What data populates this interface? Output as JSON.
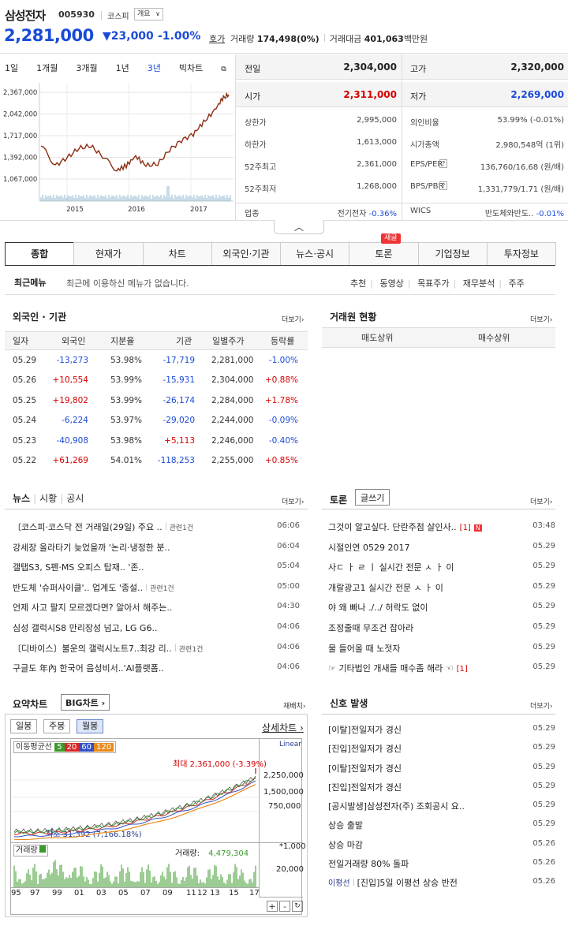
{
  "header": {
    "name": "삼성전자",
    "code": "005930",
    "market": "코스피",
    "overview_dd": "개요",
    "price": "2,281,000",
    "change": "▼23,000",
    "change_pct": "-1.00%",
    "hoga": "호가",
    "vol_label": "거래량",
    "vol": "174,498(0%)",
    "amt_label": "거래대금",
    "amt": "401,063",
    "amt_unit": "백만원"
  },
  "periods": [
    "1일",
    "1개월",
    "3개월",
    "1년",
    "3년",
    "빅차트"
  ],
  "mini_chart": {
    "y_ticks": [
      "2,367,000",
      "2,042,000",
      "1,717,000",
      "1,392,000",
      "1,067,000"
    ],
    "x_ticks": [
      "2015",
      "2016",
      "2017"
    ],
    "line_color": "#8b2e12"
  },
  "info": {
    "prev_label": "전일",
    "prev": "2,304,000",
    "high_label": "고가",
    "high": "2,320,000",
    "open_label": "시가",
    "open": "2,311,000",
    "low_label": "저가",
    "low": "2,269,000",
    "rows": [
      {
        "l": "상한가",
        "v": "2,995,000",
        "l2": "외인비율",
        "v2": "53.99% (-0.01%)"
      },
      {
        "l": "하한가",
        "v": "1,613,000",
        "l2": "시가총액",
        "v2": "2,980,548억 (1위)"
      },
      {
        "l": "52주최고",
        "v": "2,361,000",
        "l2": "EPS/PER",
        "v2": "136,760/16.68 (원/배)"
      },
      {
        "l": "52주최저",
        "v": "1,268,000",
        "l2": "BPS/PBR",
        "v2": "1,331,779/1.71 (원/배)"
      }
    ],
    "sector_label": "업종",
    "sector": "전기전자",
    "sector_chg": "-0.36%",
    "wics_label": "WICS",
    "wics": "반도체와반도..",
    "wics_chg": "-0.01%"
  },
  "tabs": [
    "종합",
    "현재가",
    "차트",
    "외국인·기관",
    "뉴스·공시",
    "토론",
    "기업정보",
    "투자정보"
  ],
  "new_badge": "새글",
  "recent": {
    "label": "최근메뉴",
    "text": "최근에 이용하신 메뉴가 없습니다.",
    "links": [
      "추천",
      "동영상",
      "목표주가",
      "재무분석",
      "주주"
    ]
  },
  "foreign": {
    "title": "외국인 · 기관",
    "more": "더보기",
    "headers": [
      "일자",
      "외국인",
      "지분율",
      "기관",
      "일별주가",
      "등락률"
    ],
    "rows": [
      [
        "05.29",
        "-13,273",
        "53.98%",
        "-17,719",
        "2,281,000",
        "-1.00%"
      ],
      [
        "05.26",
        "+10,554",
        "53.99%",
        "-15,931",
        "2,304,000",
        "+0.88%"
      ],
      [
        "05.25",
        "+19,802",
        "53.99%",
        "-26,174",
        "2,284,000",
        "+1.78%"
      ],
      [
        "05.24",
        "-6,224",
        "53.97%",
        "-29,020",
        "2,244,000",
        "-0.09%"
      ],
      [
        "05.23",
        "-40,908",
        "53.98%",
        "+5,113",
        "2,246,000",
        "-0.40%"
      ],
      [
        "05.22",
        "+61,269",
        "54.01%",
        "-118,253",
        "2,255,000",
        "+0.85%"
      ]
    ]
  },
  "broker": {
    "title": "거래원 현황",
    "more": "더보기",
    "sell": "매도상위",
    "buy": "매수상위"
  },
  "news": {
    "tabs": [
      "뉴스",
      "시황",
      "공시"
    ],
    "more": "더보기",
    "items": [
      {
        "t": "〔코스피·코스닥 전 거래일(29일) 주요 ..",
        "rel": "관련1건",
        "d": "06:06"
      },
      {
        "t": "강세장 올라타기 늦었을까 '논리·냉정한 분..",
        "rel": "",
        "d": "06:04"
      },
      {
        "t": "갤탭S3, S펜·MS 오피스 탑재.. '존..",
        "rel": "",
        "d": "05:04"
      },
      {
        "t": "반도체 '슈퍼사이클'.. 업계도 '종설..",
        "rel": "관련1건",
        "d": "05:00"
      },
      {
        "t": "언제 사고 팔지 모르겠다면? 알아서 해주는..",
        "rel": "",
        "d": "04:30"
      },
      {
        "t": "심성 갤럭시S8 만리장성 넘고, LG G6..",
        "rel": "",
        "d": "04:06"
      },
      {
        "t": "〔디바이스〕불운의 갤럭시노트7..최강 리..",
        "rel": "관련1건",
        "d": "04:06"
      },
      {
        "t": "구글도 年內 한국어 음성비서..'AI플랫폼..",
        "rel": "",
        "d": "04:06"
      }
    ]
  },
  "forum": {
    "title": "토론",
    "write": "글쓰기",
    "more": "더보기",
    "items": [
      {
        "t": "그것이 알고싶다. 단란주점 살인사..",
        "c": "[1]",
        "n": "N",
        "d": "03:48"
      },
      {
        "t": "시절인연 0529 2017",
        "c": "",
        "n": "",
        "d": "05.29"
      },
      {
        "t": "사ㄷ ㅏ ㄹ ㅣ 실시간 전문 ㅅ ㅏ 이",
        "c": "",
        "n": "",
        "d": "05.29"
      },
      {
        "t": "개랄광고1 실시간 전문 ㅅ ㅏ 이",
        "c": "",
        "n": "",
        "d": "05.29"
      },
      {
        "t": "야 왜 빠나 ./../ 허락도 없이",
        "c": "",
        "n": "",
        "d": "05.29"
      },
      {
        "t": "조정줄때 무조건 잡아라",
        "c": "",
        "n": "",
        "d": "05.29"
      },
      {
        "t": "물 들어올 때 노젓자",
        "c": "",
        "n": "",
        "d": "05.29"
      },
      {
        "t": "☞ 기타법인 개새들 매수좀 해라 ☜",
        "c": "[1]",
        "n": "",
        "d": "05.29"
      }
    ]
  },
  "summary_chart": {
    "title": "요약차트",
    "big": "BIG차트",
    "refresh": "재배치",
    "btns": [
      "일봉",
      "주봉",
      "월봉"
    ],
    "detail": "상세차트",
    "ma_label": "이동평균선",
    "ma": [
      "5",
      "20",
      "60",
      "120"
    ],
    "scale": "Linear",
    "max_label": "최대",
    "max_val": "2,361,000 (-3.39%)",
    "min_label": "최소",
    "min_val": "31,392 (7,166.18%)",
    "y_ticks": [
      "2,250,000",
      "1,500,000",
      "750,000"
    ],
    "vol_label": "거래량",
    "vol_text_label": "거래량:",
    "vol_value": "4,479,304",
    "vol_unit": "*1,000",
    "vol_tick": "20,000",
    "x_ticks": [
      "95",
      "97",
      "99",
      "01",
      "03",
      "05",
      "07",
      "09",
      "11",
      "12",
      "13",
      "15",
      "17"
    ]
  },
  "signal": {
    "title": "신호 발생",
    "more": "더보기",
    "items": [
      {
        "t": "[이탈]전일저가 경신",
        "d": "05.29"
      },
      {
        "t": "[진입]전일저가 경신",
        "d": "05.29"
      },
      {
        "t": "[이탈]전일저가 경신",
        "d": "05.29"
      },
      {
        "t": "[진입]전일저가 경신",
        "d": "05.29"
      },
      {
        "t": "[공시발생]삼성전자(주) 조회공시 요..",
        "d": "05.29"
      },
      {
        "t": "상승 출발",
        "d": "05.29"
      },
      {
        "t": "상승 마감",
        "d": "05.26"
      },
      {
        "t": "전일거래량 80% 돌파",
        "d": "05.26"
      },
      {
        "t": "[진입]5일 이평선 상승 반전",
        "d": "05.26",
        "pre": "이평선"
      }
    ]
  }
}
